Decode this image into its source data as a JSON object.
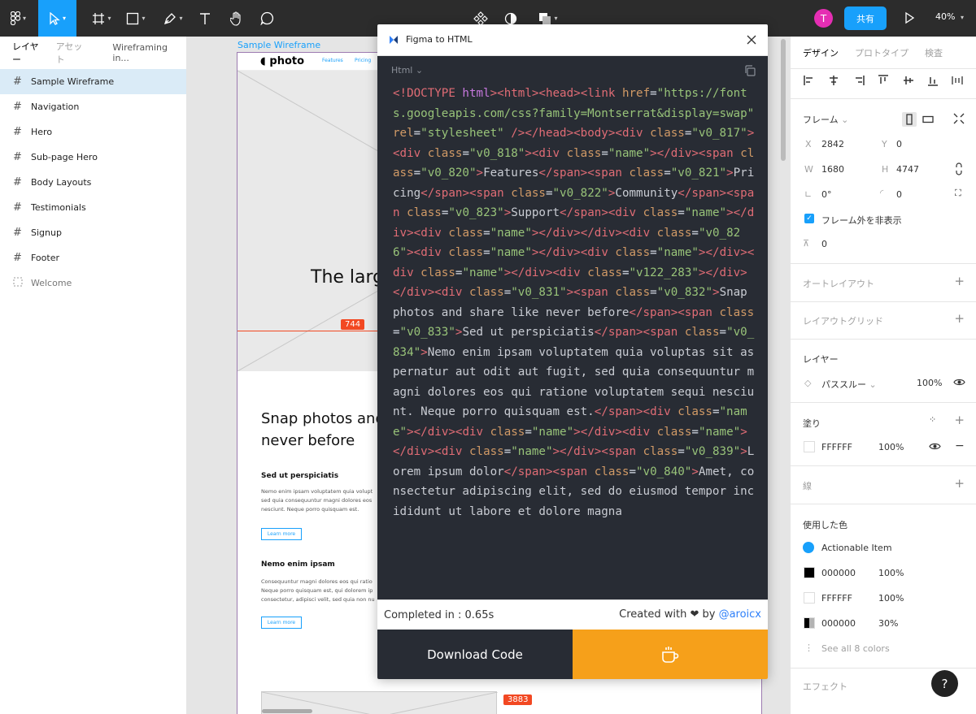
{
  "toolbar": {
    "zoom": "40%",
    "share_label": "共有",
    "user_initial": "T"
  },
  "layers_panel": {
    "tabs": [
      "レイヤー",
      "アセット"
    ],
    "page_name": "Wireframing in...",
    "items": [
      {
        "label": "Sample Wireframe"
      },
      {
        "label": "Navigation"
      },
      {
        "label": "Hero"
      },
      {
        "label": "Sub-page Hero"
      },
      {
        "label": "Body Layouts"
      },
      {
        "label": "Testimonials"
      },
      {
        "label": "Signup"
      },
      {
        "label": "Footer"
      },
      {
        "label": "Welcome"
      }
    ]
  },
  "canvas": {
    "frame_label": "Sample Wireframe",
    "logo": "photo",
    "nav_links": [
      "Features",
      "Pricing"
    ],
    "hero_title": "The larg",
    "badge_744": "744",
    "badge_3883": "3883",
    "section_title": "Snap photos and never before",
    "sub1": "Sed ut perspiciatis",
    "body1": "Nemo enim ipsam voluptatem quia volupt sed quia consequuntur magni dolores eos nesciunt. Neque porro quisquam est.",
    "learn_more": "Learn more",
    "sub2": "Nemo enim ipsam",
    "body2": "Consequuntur magni dolores eos qui ratio Neque porro quisquam est, qui dolorem ip consectetur, adipisci velit, sed quia non nu"
  },
  "plugin": {
    "title": "Figma to HTML",
    "language": "Html",
    "status": "Completed in : 0.65s",
    "created_prefix": "Created with ❤ by ",
    "author": "@aroicx",
    "download_label": "Download Code",
    "code_text": "<!DOCTYPE html><html><head><link href=\"https://fonts.googleapis.com/css?family=Montserrat&display=swap\" rel=\"stylesheet\" /></head><body><div class=\"v0_817\"><div class=\"v0_818\"><div class=\"name\"></div><span class=\"v0_820\">Features</span><span class=\"v0_821\">Pricing</span><span class=\"v0_822\">Community</span><span class=\"v0_823\">Support</span><div class=\"name\"></div><div class=\"name\"></div></div><div class=\"v0_826\"><div class=\"name\"></div><div class=\"name\"></div><div class=\"name\"></div><div class=\"v122_283\"></div></div><div class=\"v0_831\"><span class=\"v0_832\">Snap photos and share like never before</span><span class=\"v0_833\">Sed ut perspiciatis</span><span class=\"v0_834\">Nemo enim ipsam voluptatem quia voluptas sit aspernatur aut odit aut fugit, sed quia consequuntur magni dolores eos qui ratione voluptatem sequi nesciunt. Neque porro quisquam est.</span><div class=\"name\"></div><div class=\"name\"></div><div class=\"name\"></div><div class=\"name\"></div><span class=\"v0_839\">Lorem ipsum dolor</span><span class=\"v0_840\">Amet, consectetur adipiscing elit, sed do eiusmod tempor incididunt ut labore et dolore magna"
  },
  "design_panel": {
    "tabs": [
      "デザイン",
      "プロトタイプ",
      "検査"
    ],
    "frame_label": "フレーム",
    "x_label": "X",
    "x": "2842",
    "y_label": "Y",
    "y": "0",
    "w_label": "W",
    "w": "1680",
    "h_label": "H",
    "h": "4747",
    "rotation": "0°",
    "radius": "0",
    "clip_content": "フレーム外を非表示",
    "spacing": "0",
    "auto_layout": "オートレイアウト",
    "layout_grid": "レイアウトグリッド",
    "layer_heading": "レイヤー",
    "blend": "パススルー",
    "layer_opacity": "100%",
    "fill_heading": "塗り",
    "fill_hex": "FFFFFF",
    "fill_opacity": "100%",
    "stroke_heading": "線",
    "colors_heading": "使用した色",
    "colors": [
      {
        "name": "Actionable Item",
        "swatch": "#18a0fb"
      },
      {
        "name": "000000",
        "opacity": "100%",
        "swatch": "#000000"
      },
      {
        "name": "FFFFFF",
        "opacity": "100%",
        "swatch": "#ffffff"
      },
      {
        "name": "000000",
        "opacity": "30%",
        "swatch": "#000000"
      }
    ],
    "see_all": "See all 8 colors",
    "effects": "エフェクト"
  },
  "help_label": "?"
}
